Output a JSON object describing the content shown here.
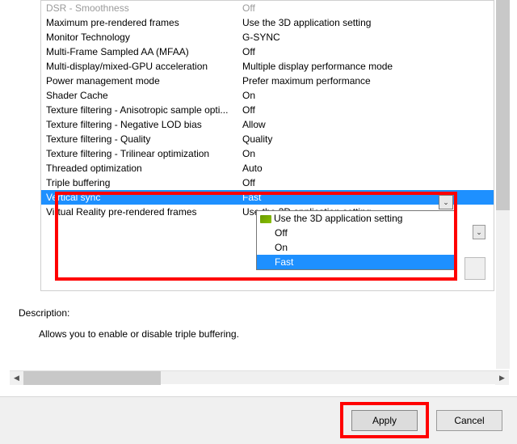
{
  "settings": [
    {
      "name": "DSR - Smoothness",
      "value": "Off",
      "dim": true
    },
    {
      "name": "Maximum pre-rendered frames",
      "value": "Use the 3D application setting"
    },
    {
      "name": "Monitor Technology",
      "value": "G-SYNC"
    },
    {
      "name": "Multi-Frame Sampled AA (MFAA)",
      "value": "Off"
    },
    {
      "name": "Multi-display/mixed-GPU acceleration",
      "value": "Multiple display performance mode"
    },
    {
      "name": "Power management mode",
      "value": "Prefer maximum performance"
    },
    {
      "name": "Shader Cache",
      "value": "On"
    },
    {
      "name": "Texture filtering - Anisotropic sample opti...",
      "value": "Off"
    },
    {
      "name": "Texture filtering - Negative LOD bias",
      "value": "Allow"
    },
    {
      "name": "Texture filtering - Quality",
      "value": "Quality"
    },
    {
      "name": "Texture filtering - Trilinear optimization",
      "value": "On"
    },
    {
      "name": "Threaded optimization",
      "value": "Auto"
    },
    {
      "name": "Triple buffering",
      "value": "Off"
    },
    {
      "name": "Vertical sync",
      "value": "Fast",
      "highlight": true
    },
    {
      "name": "Virtual Reality pre-rendered frames",
      "value": "Use the 3D application setting"
    }
  ],
  "dropdown": {
    "options": [
      "Use the 3D application setting",
      "Off",
      "On",
      "Fast"
    ],
    "selected": "Fast"
  },
  "description": {
    "label": "Description:",
    "text": "Allows you to enable or disable triple buffering."
  },
  "buttons": {
    "apply": "Apply",
    "cancel": "Cancel"
  }
}
